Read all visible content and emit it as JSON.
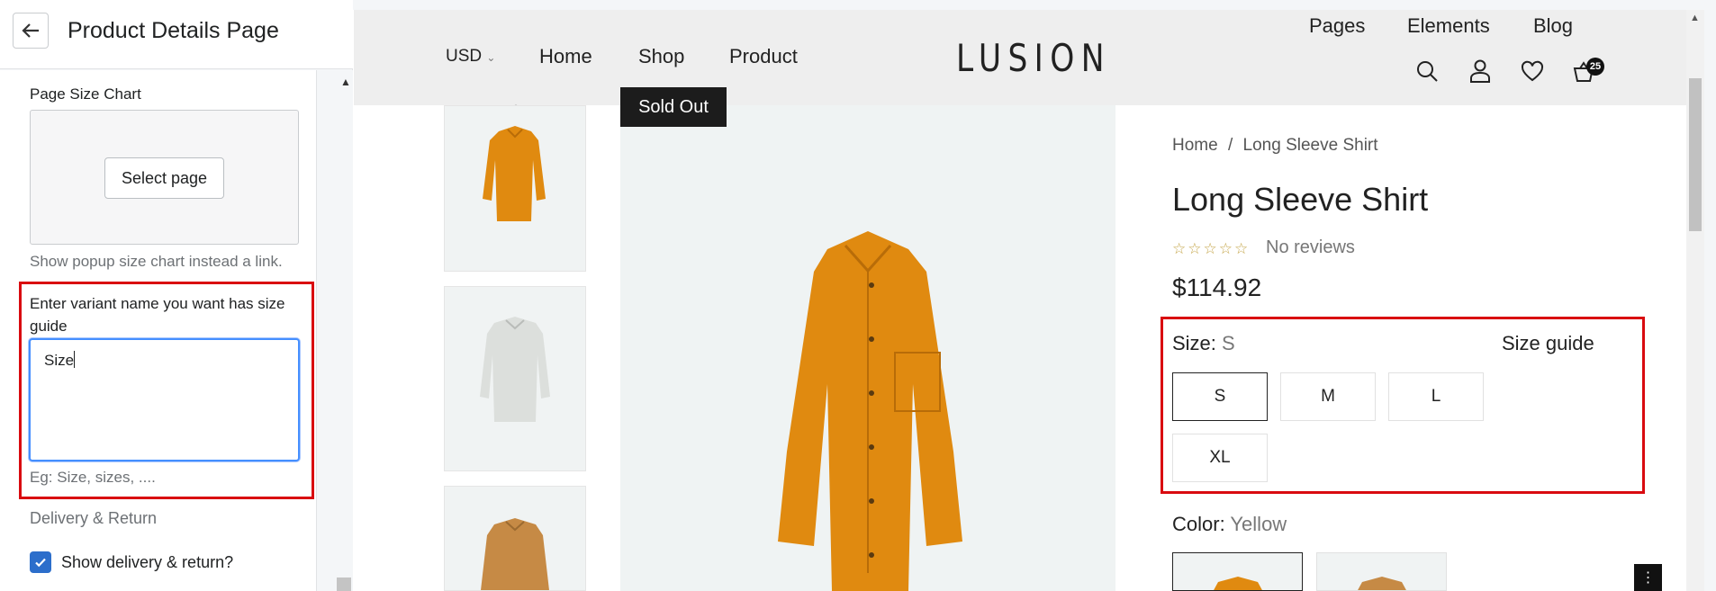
{
  "editor": {
    "title": "Product Details Page",
    "page_size_chart_label": "Page Size Chart",
    "select_page_button": "Select page",
    "popup_help": "Show popup size chart instead a link.",
    "variant_label": "Enter variant name you want has size guide",
    "variant_value": "Size",
    "variant_help": "Eg: Size, sizes, ....",
    "delivery_section": "Delivery & Return",
    "show_delivery_label": "Show delivery & return?",
    "show_delivery_checked": true
  },
  "store": {
    "currency": "USD",
    "nav_left": [
      "Home",
      "Shop",
      "Product"
    ],
    "nav_right": [
      "Pages",
      "Elements",
      "Blog"
    ],
    "logo": "LUSION",
    "cart_count": "25",
    "icons": [
      "search-icon",
      "user-icon",
      "heart-icon",
      "cart-icon"
    ],
    "sold_out": "Sold Out",
    "thumbnails": [
      "orange-shirt",
      "white-shirt",
      "tan-shirt"
    ]
  },
  "product": {
    "breadcrumb_home": "Home",
    "breadcrumb_sep": "/",
    "breadcrumb_current": "Long Sleeve Shirt",
    "title": "Long Sleeve Shirt",
    "rating_stars": 0,
    "stars_display": "☆☆☆☆☆",
    "reviews": "No reviews",
    "price": "$114.92",
    "size_label": "Size:",
    "size_value": "S",
    "size_guide": "Size guide",
    "sizes": [
      "S",
      "M",
      "L",
      "XL"
    ],
    "selected_size": "S",
    "color_label": "Color:",
    "color_value": "Yellow",
    "colors": [
      "orange",
      "tan"
    ]
  },
  "colors": {
    "highlight": "#d90b10",
    "focus": "#458fff",
    "checkbox": "#2c6ecb",
    "shirt_orange": "#e08a10",
    "shirt_white": "#dcdfdc",
    "shirt_tan": "#c68a45"
  }
}
